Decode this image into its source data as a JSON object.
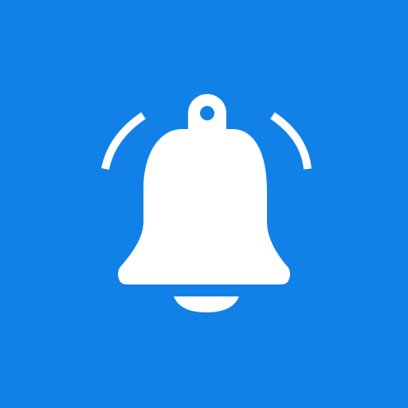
{
  "app_icon": {
    "icon": "bell-icon",
    "background_color": "#1181E8",
    "foreground_color": "#FFFFFF",
    "decorations": [
      "ring-wave-left",
      "ring-wave-right"
    ]
  }
}
